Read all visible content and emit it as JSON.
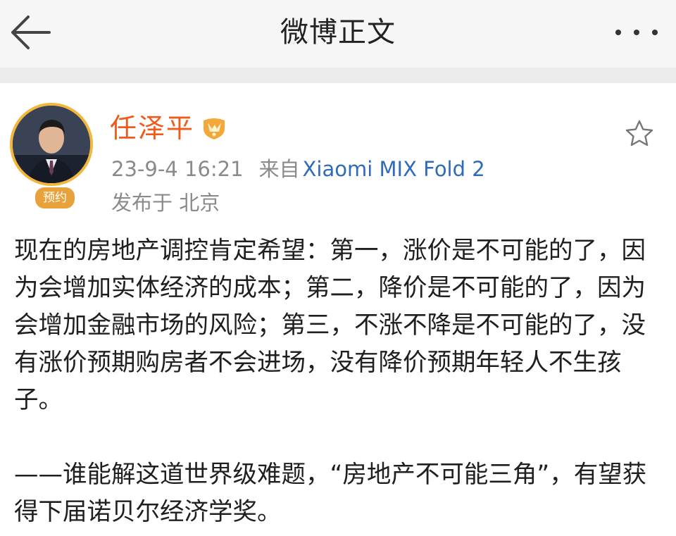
{
  "header": {
    "title": "微博正文",
    "back_icon": "back-arrow-icon",
    "more_icon": "more-dots-icon"
  },
  "post": {
    "author": {
      "name": "任泽平",
      "badge": "预约",
      "verified_icon": "verified-badge-icon",
      "avatar_ring_color": "#f2b63c",
      "name_color": "#f05a1a"
    },
    "timestamp": "23-9-4 16:21",
    "source_prefix": "来自",
    "device": "Xiaomi MIX Fold 2",
    "location": "发布于 北京",
    "favorite_icon": "star-outline-icon",
    "paragraphs": [
      "现在的房地产调控肯定希望：第一，涨价是不可能的了，因为会增加实体经济的成本；第二，降价是不可能的了，因为会增加金融市场的风险；第三，不涨不降是不可能的了，没有涨价预期购房者不会进场，没有降价预期年轻人不生孩子。",
      "——谁能解这道世界级难题，“房地产不可能三角”，有望获得下届诺贝尔经济学奖。"
    ]
  },
  "colors": {
    "link": "#2f6bb8",
    "meta_text": "#8a8a8a",
    "topbar_bg": "#f6f6f6"
  }
}
